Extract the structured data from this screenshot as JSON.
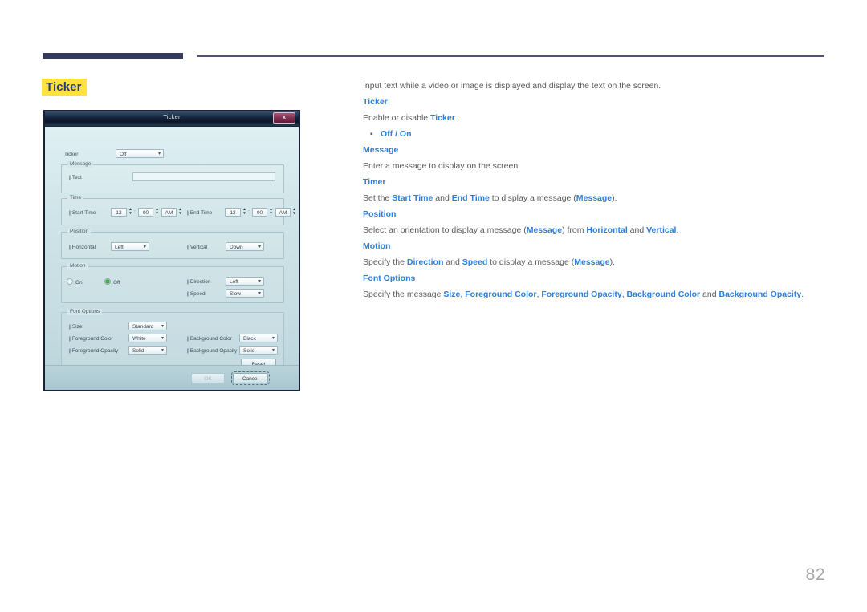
{
  "page": {
    "number": "82",
    "title": "Ticker"
  },
  "dialog": {
    "title": "Ticker",
    "close_label": "x",
    "ticker_row": {
      "label": "Ticker",
      "value": "Off"
    },
    "message_group": {
      "label": "Message",
      "text_label": "Text",
      "text_value": ""
    },
    "time_group": {
      "label": "Time",
      "start_label": "Start Time",
      "start_hour": "12",
      "start_minute": "00",
      "start_meridiem": "AM",
      "end_label": "End Time",
      "end_hour": "12",
      "end_minute": "00",
      "end_meridiem": "AM",
      "colon": ":"
    },
    "position_group": {
      "label": "Position",
      "horizontal_label": "Horizontal",
      "horizontal_value": "Left",
      "vertical_label": "Vertical",
      "vertical_value": "Down"
    },
    "motion_group": {
      "label": "Motion",
      "on_label": "On",
      "off_label": "Off",
      "selected": "Off",
      "direction_label": "Direction",
      "direction_value": "Left",
      "speed_label": "Speed",
      "speed_value": "Slow"
    },
    "font_options_group": {
      "label": "Font Options",
      "size_label": "Size",
      "size_value": "Standard",
      "foreground_color_label": "Foreground Color",
      "foreground_color_value": "White",
      "background_color_label": "Background Color",
      "background_color_value": "Black",
      "foreground_opacity_label": "Foreground Opacity",
      "foreground_opacity_value": "Solid",
      "background_opacity_label": "Background Opacity",
      "background_opacity_value": "Solid",
      "reset_label": "Reset"
    },
    "footer": {
      "ok_label": "OK",
      "cancel_label": "Cancel"
    },
    "dropdown_arrow": "▾",
    "tick_marker": "|"
  },
  "content": {
    "intro": "Input text while a video or image is displayed and display the text on the screen.",
    "sections": [
      {
        "heading": "Ticker",
        "body_html": "Enable or disable <span class=\"bl\">Ticker</span>.",
        "bullet": "Off / On"
      },
      {
        "heading": "Message",
        "body_html": "Enter a message to display on the screen."
      },
      {
        "heading": "Timer",
        "body_html": "Set the <span class=\"bl\">Start Time</span> and <span class=\"bl\">End Time</span> to display a message (<span class=\"bl\">Message</span>)."
      },
      {
        "heading": "Position",
        "body_html": "Select an orientation to display a message (<span class=\"bl\">Message</span>) from <span class=\"bl\">Horizontal</span> and <span class=\"bl\">Vertical</span>."
      },
      {
        "heading": "Motion",
        "body_html": "Specify the <span class=\"bl\">Direction</span> and <span class=\"bl\">Speed</span> to display a message (<span class=\"bl\">Message</span>)."
      },
      {
        "heading": "Font Options",
        "body_html": "Specify the message <span class=\"bl\">Size</span>, <span class=\"bl\">Foreground Color</span>, <span class=\"bl\">Foreground Opacity</span>, <span class=\"bl\">Background Color</span> and <span class=\"bl\">Background Opacity</span>."
      }
    ]
  },
  "colors": {
    "accent_blue": "#2b7de0",
    "highlight_yellow": "#ffe13f",
    "rule_navy": "#343a5e",
    "body_text": "#58595b"
  }
}
